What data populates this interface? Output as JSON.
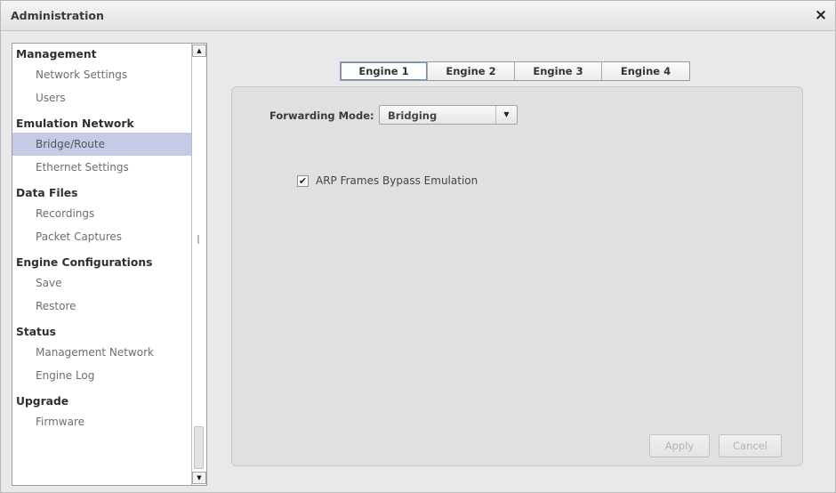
{
  "window": {
    "title": "Administration",
    "close_glyph": "×"
  },
  "sidebar": {
    "sections": [
      {
        "title": "Management",
        "items": [
          {
            "label": "Network Settings",
            "selected": false
          },
          {
            "label": "Users",
            "selected": false
          }
        ]
      },
      {
        "title": "Emulation Network",
        "items": [
          {
            "label": "Bridge/Route",
            "selected": true
          },
          {
            "label": "Ethernet Settings",
            "selected": false
          }
        ]
      },
      {
        "title": "Data Files",
        "items": [
          {
            "label": "Recordings",
            "selected": false
          },
          {
            "label": "Packet Captures",
            "selected": false
          }
        ]
      },
      {
        "title": "Engine Configurations",
        "items": [
          {
            "label": "Save",
            "selected": false
          },
          {
            "label": "Restore",
            "selected": false
          }
        ]
      },
      {
        "title": "Status",
        "items": [
          {
            "label": "Management Network",
            "selected": false
          },
          {
            "label": "Engine Log",
            "selected": false
          }
        ]
      },
      {
        "title": "Upgrade",
        "items": [
          {
            "label": "Firmware",
            "selected": false
          }
        ]
      }
    ],
    "scroll_up_glyph": "▲",
    "scroll_down_glyph": "▼"
  },
  "tabs": [
    {
      "label": "Engine 1",
      "active": true
    },
    {
      "label": "Engine 2",
      "active": false
    },
    {
      "label": "Engine 3",
      "active": false
    },
    {
      "label": "Engine 4",
      "active": false
    }
  ],
  "form": {
    "forwarding_mode_label": "Forwarding Mode:",
    "forwarding_mode_value": "Bridging",
    "dropdown_arrow_glyph": "▼",
    "arp_checkbox_checked": true,
    "arp_checkbox_glyph": "✔",
    "arp_checkbox_label": "ARP Frames Bypass Emulation"
  },
  "buttons": {
    "apply_label": "Apply",
    "cancel_label": "Cancel"
  },
  "colors": {
    "selected_item_bg": "#c5cbe6",
    "panel_bg": "#e0e0e0",
    "window_bg": "#e9e9e9"
  },
  "icons": {
    "close": "close-icon",
    "scroll_up": "scroll-up-icon",
    "scroll_down": "scroll-down-icon",
    "dropdown": "chevron-down-icon",
    "checkmark": "checkmark-icon"
  }
}
